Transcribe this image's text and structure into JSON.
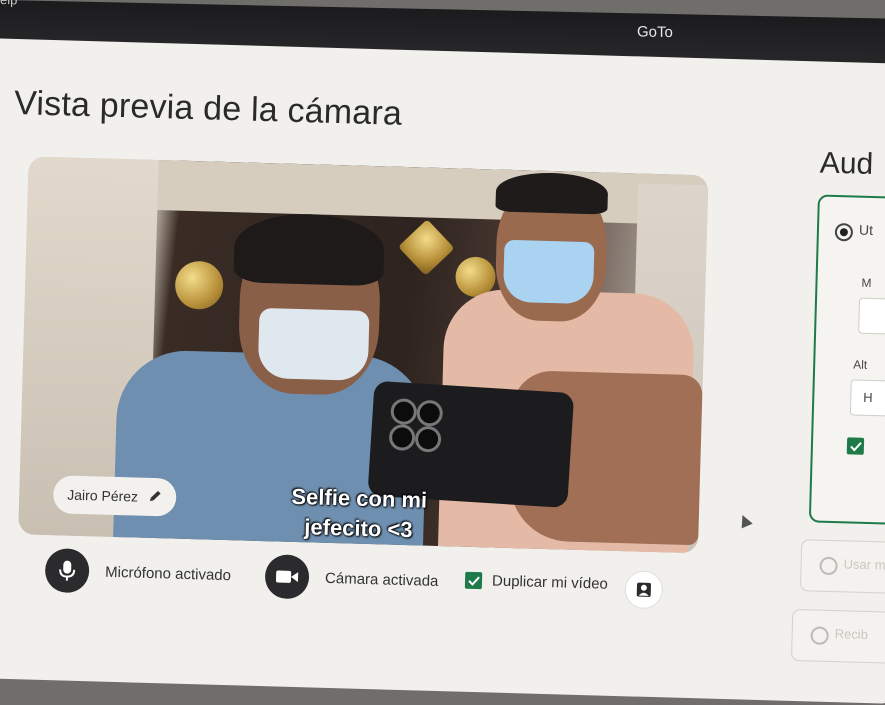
{
  "window": {
    "menu_partial": "elp",
    "app_title": "GoTo"
  },
  "preview": {
    "title": "Vista previa de la cámara",
    "participant_name": "Jairo Pérez",
    "overlay_caption_line1": "Selfie con mi",
    "overlay_caption_line2": "jefecito <3"
  },
  "controls": {
    "microphone_label": "Micrófono activado",
    "camera_label": "Cámara activada",
    "mirror_label": "Duplicar mi vídeo",
    "mirror_checked": true
  },
  "side_panel": {
    "title_partial": "Aud",
    "option1_partial": "Ut",
    "field1_label_partial": "M",
    "field2_label_partial": "Alt",
    "field2_value_partial": "H",
    "option2_partial": "Usar m",
    "option3_partial": "Recib"
  },
  "colors": {
    "accent_green": "#1f7a4a",
    "panel_bg": "#f1f0ec",
    "titlebar_bg": "#1b1b1d"
  }
}
